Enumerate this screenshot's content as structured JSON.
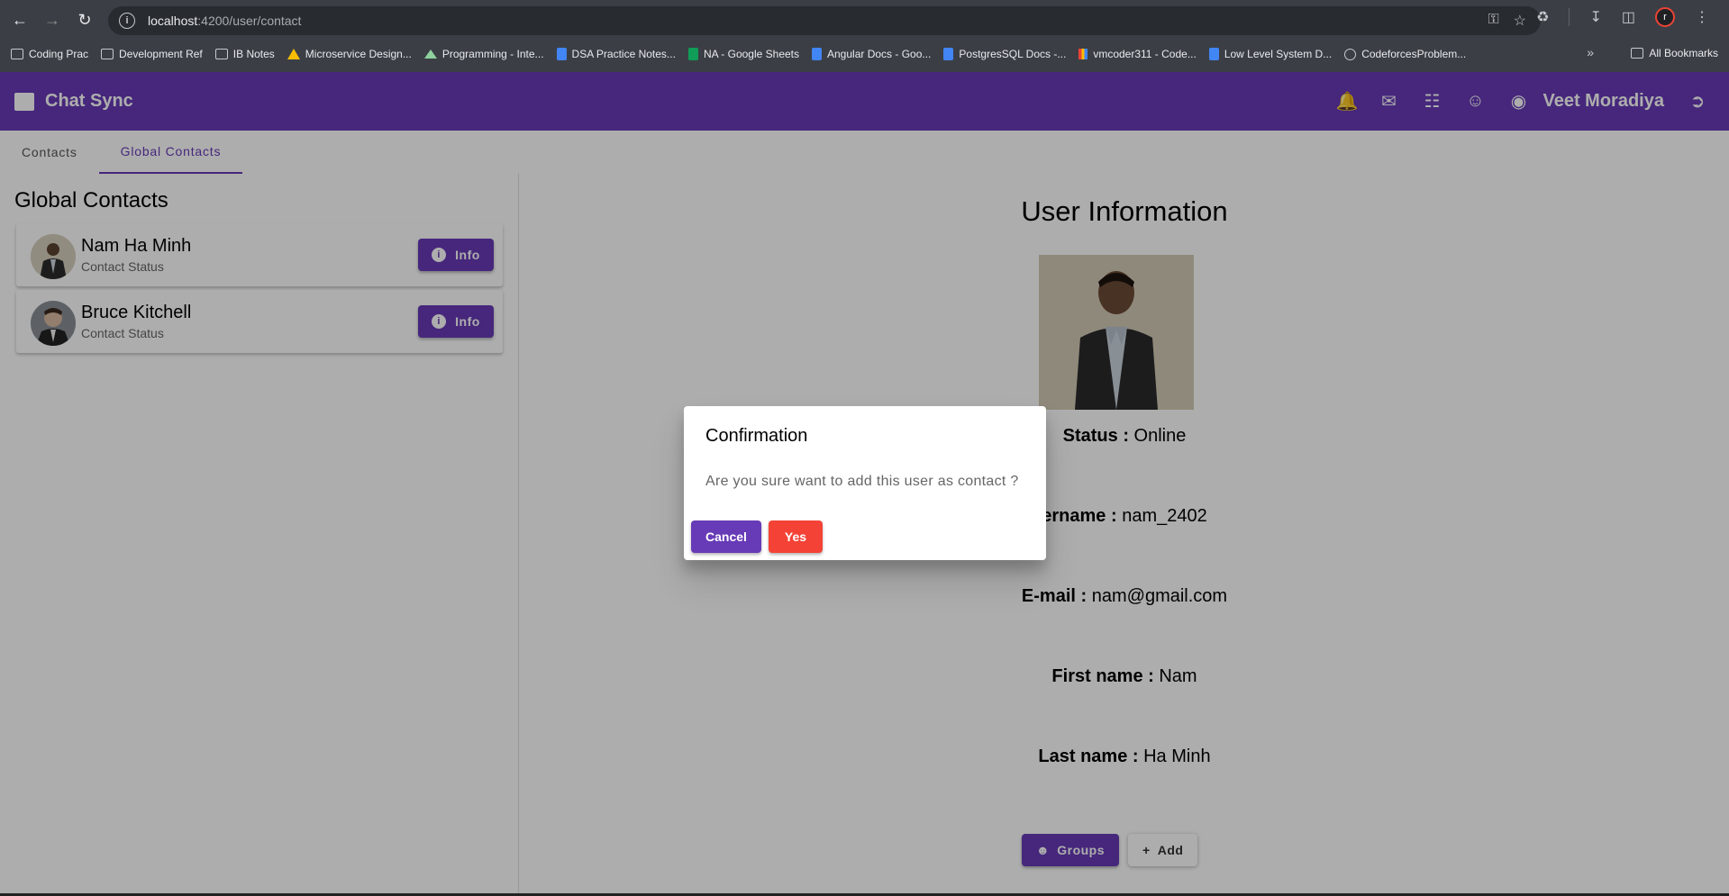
{
  "browser": {
    "url_host": "localhost",
    "url_path": ":4200/user/contact",
    "bookmarks": [
      {
        "label": "Coding Prac",
        "icon": "folder-icon"
      },
      {
        "label": "Development Ref",
        "icon": "folder-icon"
      },
      {
        "label": "IB Notes",
        "icon": "folder-icon"
      },
      {
        "label": "Microservice Design...",
        "icon": "drive-icon"
      },
      {
        "label": "Programming - Inte...",
        "icon": "mountain-icon"
      },
      {
        "label": "DSA Practice Notes...",
        "icon": "doc-icon"
      },
      {
        "label": "NA - Google Sheets",
        "icon": "sheet-icon"
      },
      {
        "label": "Angular Docs - Goo...",
        "icon": "doc-icon"
      },
      {
        "label": "PostgresSQL Docs -...",
        "icon": "doc-icon"
      },
      {
        "label": "vmcoder311 - Code...",
        "icon": "bars-icon"
      },
      {
        "label": "Low Level System D...",
        "icon": "doc-icon"
      },
      {
        "label": "CodeforcesProblem...",
        "icon": "globe-icon"
      }
    ],
    "more_label": "»",
    "all_bookmarks": "All Bookmarks"
  },
  "app": {
    "title": "Chat Sync",
    "user_name": "Veet Moradiya",
    "brand_color": "#673ab7"
  },
  "tabs": [
    {
      "label": "Contacts",
      "active": false
    },
    {
      "label": "Global Contacts",
      "active": true
    }
  ],
  "left_panel": {
    "title": "Global Contacts",
    "contacts": [
      {
        "name": "Nam Ha Minh",
        "status": "Contact Status",
        "button": "Info"
      },
      {
        "name": "Bruce Kitchell",
        "status": "Contact Status",
        "button": "Info"
      }
    ]
  },
  "detail": {
    "title": "User Information",
    "status_label": "Status :",
    "status_value": "Online",
    "username_label": "ername :",
    "username_value": "nam_2402",
    "email_label": "E-mail :",
    "email_value": "nam@gmail.com",
    "first_label": "First name :",
    "first_value": "Nam",
    "last_label": "Last name :",
    "last_value": "Ha Minh",
    "groups_button": "Groups",
    "add_button": "Add"
  },
  "dialog": {
    "title": "Confirmation",
    "message": "Are you sure want to add this user as contact ?",
    "cancel": "Cancel",
    "yes": "Yes",
    "yes_color": "#f44336"
  }
}
